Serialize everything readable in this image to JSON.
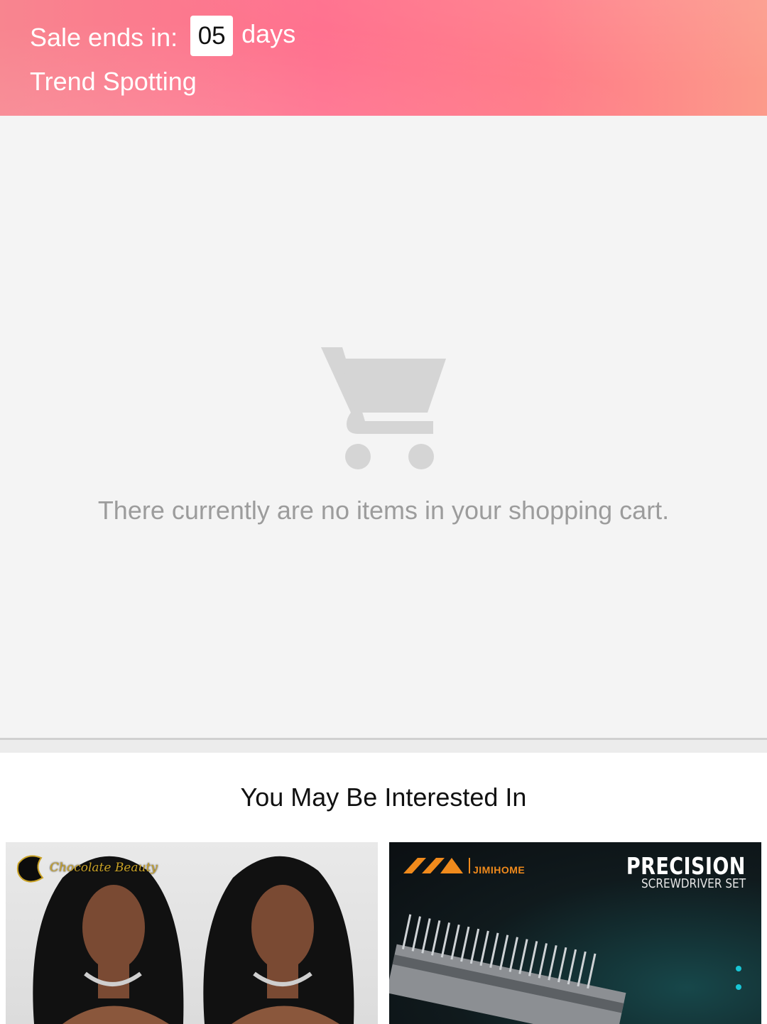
{
  "banner": {
    "sale_label": "Sale ends in:",
    "countdown_value": "05",
    "countdown_unit": "days",
    "subtitle": "Trend Spotting",
    "colors": {
      "gradient_start": "#f8858f",
      "gradient_mid": "#ff6f8d",
      "gradient_end": "#fc9a8a"
    }
  },
  "cart": {
    "icon": "shopping-cart-icon",
    "empty_message": "There currently are no items in your shopping cart."
  },
  "recommendations": {
    "title": "You May Be Interested In",
    "products": [
      {
        "image": "wig-model-photo",
        "brand_text": "Chocolate Beauty"
      },
      {
        "image": "screwdriver-set-photo",
        "brand_text": "JIMIHOME",
        "headline": "PRECISION",
        "subheadline": "SCREWDRIVER SET"
      }
    ]
  }
}
